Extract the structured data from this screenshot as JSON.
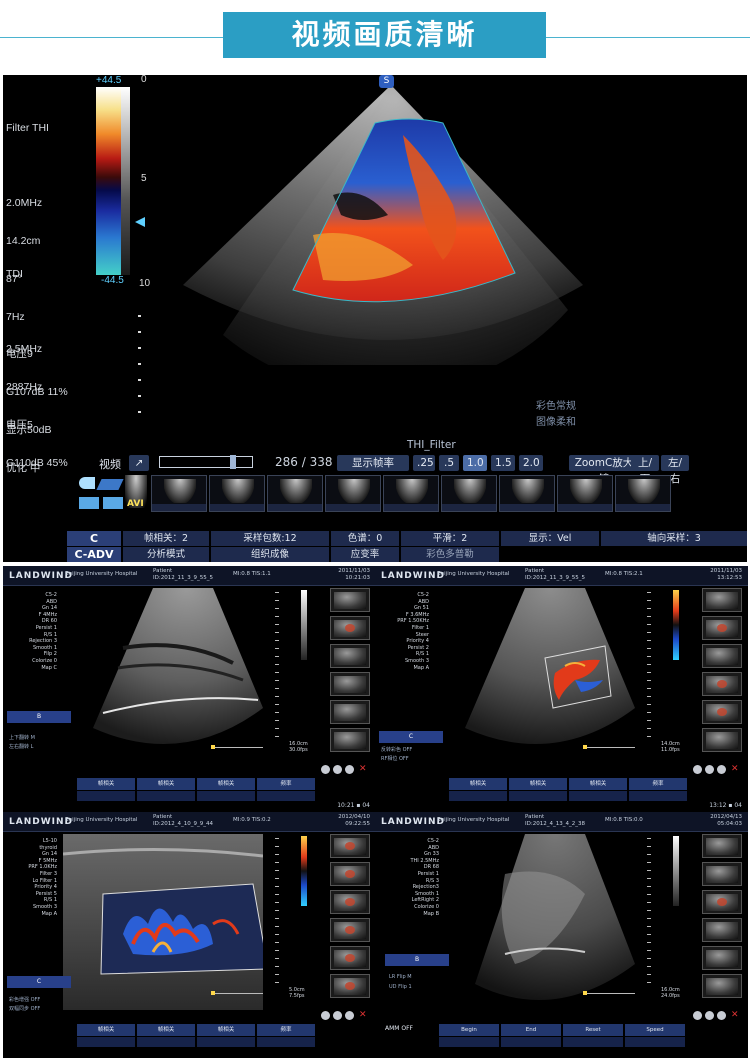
{
  "banner": {
    "title": "视频画质清晰"
  },
  "top_screen": {
    "params_thi": [
      "Filter THI",
      "",
      "2.0MHz",
      "14.2cm",
      "87°",
      "7Hz",
      "电压9",
      "G107dB 11%",
      "显示50dB",
      "优化 中"
    ],
    "params_tdi": [
      "TDI",
      "",
      "2.5MHz",
      "2887Hz",
      "电压5",
      "G110dB 45%"
    ],
    "colorbar": {
      "top_label": "+44.5",
      "bottom_label": "-44.5",
      "scale_top": "0",
      "scale_mid": "5",
      "scale_bot": "10"
    },
    "probe_badge": "S",
    "mode_names": [
      "彩色常规",
      "图像柔和"
    ],
    "mode_label": "THI_Filter",
    "controls": {
      "video_label": "视频",
      "video_progress": 0.8,
      "frame_counter": "286 / 338",
      "display_rate_label": "显示帧率",
      "rates": [
        ".25",
        ".5",
        "1.0",
        "1.5",
        "2.0"
      ],
      "selected_rate": "1.0",
      "zoom_button": "ZoomC放大镜",
      "updown_button": "上/下",
      "leftright_button": "左/右"
    },
    "thumb_tag": "AVI",
    "table": {
      "row1": {
        "head": "C",
        "cells": [
          "帧相关：2",
          "采样包数:12",
          "色谱：0",
          "平滑：2",
          "显示：Vel",
          "轴向采样：3"
        ]
      },
      "row2": {
        "head": "C-ADV",
        "cells": [
          "分析模式",
          "组织成像",
          "应变率",
          "彩色多普勒"
        ]
      }
    }
  },
  "panels": [
    {
      "logo": "LANDWIND",
      "hospital": "Beijing University Hospital",
      "patient": [
        "Patient",
        "ID:2012_11_3_9_55_5"
      ],
      "mi": "MI:0.8 TIS:1.1",
      "date": [
        "2011/11/03",
        "10:21:03"
      ],
      "params": [
        "C5-2",
        "ABD",
        "Gn 14",
        "F 4MHz",
        "DR 60",
        "Persist 1",
        "R/S 1",
        "Rejection 3",
        "Smooth 1",
        "Filp 2",
        "Colorize 0",
        "Map C"
      ],
      "depth": [
        "16.0cm",
        "30.0fps"
      ],
      "ctl_head": "B",
      "ctl_rows": [
        "上下翻转 M",
        "左右翻转 L"
      ],
      "footer": [
        "帧相关",
        "帧相关",
        "帧相关",
        "频率"
      ],
      "time": "10:21 ▪ 04"
    },
    {
      "logo": "LANDWIND",
      "hospital": "Beijing University Hospital",
      "patient": [
        "Patient",
        "ID:2012_11_3_9_55_5"
      ],
      "mi": "MI:0.8 TIS:2.1",
      "date": [
        "2011/11/03",
        "13:12:53"
      ],
      "params": [
        "C5-2",
        "ABD",
        "Gn 51",
        "F 3.6MHz",
        "PRF 1.50KHz",
        "Filter 1",
        "Steer",
        "Priority 4",
        "Persist 2",
        "R/S 1",
        "Smooth 3",
        "Map A"
      ],
      "depth": [
        "14.0cm",
        "11.0fps"
      ],
      "ctl_head": "C",
      "ctl_rows": [
        "反转彩色 OFF",
        "RF相位 OFF"
      ],
      "footer": [
        "帧相关",
        "帧相关",
        "帧相关",
        "频率"
      ],
      "time": "13:12 ▪ 04"
    },
    {
      "logo": "LANDWIND",
      "hospital": "Beijing University Hospital",
      "patient": [
        "Patient",
        "ID:2012_4_10_9_9_44"
      ],
      "mi": "MI:0.9 TIS:0.2",
      "date": [
        "2012/04/10",
        "09:22:55"
      ],
      "params": [
        "L5-10",
        "thyroid",
        "Gn 14",
        "F 5MHz",
        "PRF 1.0KHz",
        "Filter 3",
        "Lo Filter 1",
        "Priority 4",
        "Persist 5",
        "R/S 1",
        "Smooth 3",
        "Map A"
      ],
      "depth": [
        "5.0cm",
        "7.5fps"
      ],
      "ctl_head": "C",
      "ctl_rows": [
        "彩色增强 OFF",
        "双幅同步 OFF"
      ],
      "footer": [
        "帧相关",
        "帧相关",
        "帧相关",
        "频率"
      ],
      "time": ""
    },
    {
      "logo": "LANDWIND",
      "hospital": "Beijing University Hospital",
      "patient": [
        "Patient",
        "ID:2012_4_13_4_2_38"
      ],
      "mi": "MI:0.8 TIS:0.0",
      "date": [
        "2012/04/13",
        "05:04:03"
      ],
      "params": [
        "C5-2",
        "ABD",
        "Gn 33",
        "THI 2.5MHz",
        "DR 68",
        "Persist 1",
        "R/S 3",
        "Rejection3",
        "Smooth 1",
        "LeftRight 2",
        "Colorize 0",
        "Map B"
      ],
      "depth": [
        "16.0cm",
        "24.0fps"
      ],
      "ctl_head": "B",
      "ctl_rows": [
        "LR Flip M",
        "UD Flip 1",
        "AMM OFF"
      ],
      "footer": [
        "Begin",
        "End",
        "Reset",
        "Speed"
      ],
      "time": ""
    }
  ]
}
